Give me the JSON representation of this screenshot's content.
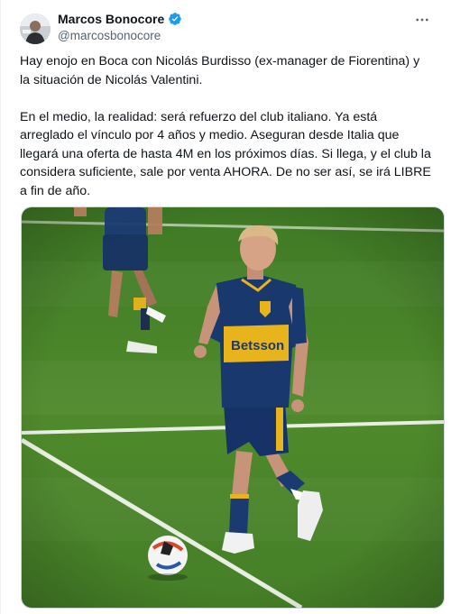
{
  "author": {
    "display_name": "Marcos Bonocore",
    "handle": "@marcosbonocore",
    "verified": true,
    "verified_icon": "verified-badge-icon",
    "verified_color": "#1d9bf0"
  },
  "more_icon": "more-options-icon",
  "tweet": {
    "paragraph_1": "Hay enojo en Boca con Nicolás Burdisso (ex-manager de Fiorentina) y la situación de Nicolás Valentini.",
    "paragraph_2": "En el medio, la realidad: será refuerzo del club italiano. Ya está arreglado el vínculo por 4 años y medio. Aseguran desde Italia que llegará una oferta de hasta 4M en los próximos días. Si llega, y el club la considera suficiente, sale por venta AHORA. De no ser así, se irá LIBRE a fin de año."
  },
  "media": {
    "jersey_text": "Betsson",
    "colors": {
      "pitch": "#4f8a2c",
      "jersey_blue": "#16336b",
      "jersey_gold": "#e8b41c"
    }
  }
}
